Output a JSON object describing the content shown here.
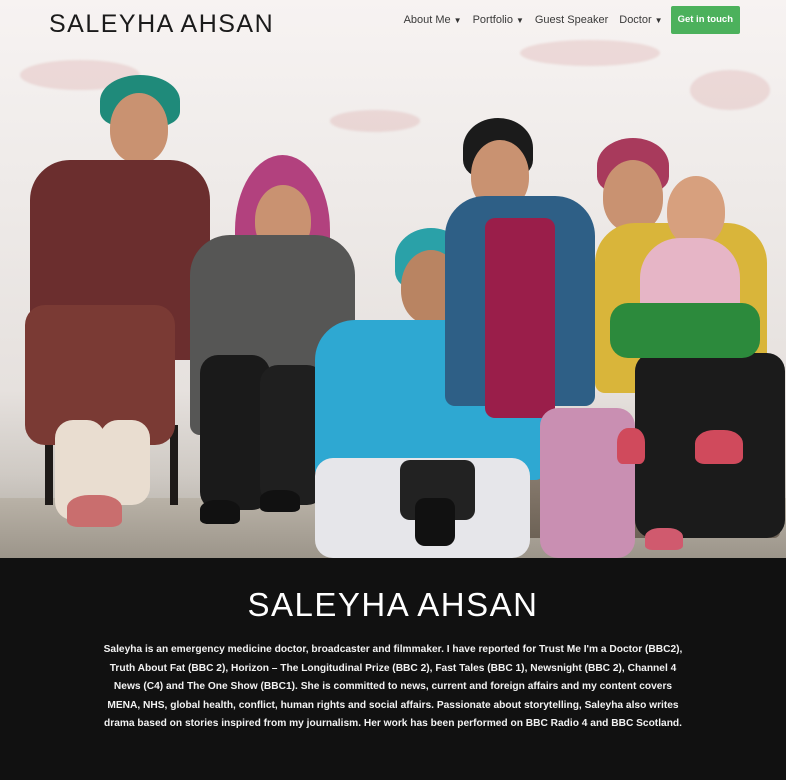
{
  "site": {
    "logo": "SALEYHA AHSAN"
  },
  "nav": {
    "items": [
      {
        "label": "About Me",
        "has_dropdown": true
      },
      {
        "label": "Portfolio",
        "has_dropdown": true
      },
      {
        "label": "Guest Speaker",
        "has_dropdown": false
      },
      {
        "label": "Doctor",
        "has_dropdown": true
      }
    ],
    "cta": "Get in touch",
    "cta_color": "#4cb15c",
    "chevron_icon": "chevron-down-icon"
  },
  "hero": {
    "image_label": "hero-photo"
  },
  "bio": {
    "title": "SALEYHA AHSAN",
    "text": "Saleyha is an emergency medicine doctor, broadcaster and filmmaker. I have reported for Trust Me I'm a Doctor (BBC2), Truth About Fat (BBC 2), Horizon – The Longitudinal Prize (BBC 2), Fast Tales (BBC 1), Newsnight (BBC 2), Channel 4 News (C4) and The One Show (BBC1). She is committed to news, current and foreign affairs and my content covers MENA, NHS, global health, conflict, human rights and social affairs. Passionate about storytelling, Saleyha also writes drama based on stories inspired from my journalism. Her work has been performed on BBC Radio 4 and BBC Scotland."
  }
}
